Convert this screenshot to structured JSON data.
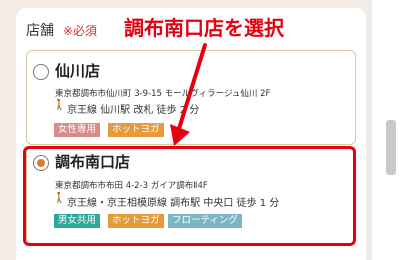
{
  "section": {
    "label": "店舗",
    "required": "※必須"
  },
  "annotation": {
    "text": "調布南口店を選択"
  },
  "stores": [
    {
      "name": "仙川店",
      "selected": false,
      "address": "東京都調布市仙川町 3-9-15 モールヴィラージュ仙川 2F",
      "access": "京王線 仙川駅 改札 徒歩 2 分",
      "tags": [
        "女性専用",
        "ホットヨガ"
      ]
    },
    {
      "name": "調布南口店",
      "selected": true,
      "address": "東京都調布市布田 4-2-3 ガイア調布Ⅱ4F",
      "access": "京王線・京王相模原線 調布駅 中央口 徒歩 1 分",
      "tags": [
        "男女共用",
        "ホットヨガ",
        "フローティング"
      ]
    }
  ],
  "colors": {
    "required": "#e0302a",
    "annotation": "#e60012",
    "radio_selected": "#e07a30",
    "tag_women": "#d98a8a",
    "tag_hotyoga": "#e59a3c",
    "tag_unisex": "#2fa89a",
    "tag_floating": "#7bb6c4"
  },
  "icons": {
    "walk": "walking-person-icon"
  }
}
